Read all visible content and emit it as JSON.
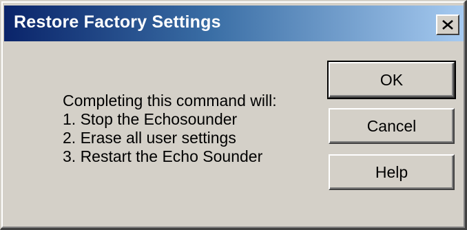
{
  "window": {
    "title": "Restore Factory Settings",
    "close_symbol": "close-icon"
  },
  "message": {
    "lines": [
      "Completing this command will:",
      "1. Stop the Echosounder",
      "2. Erase all user settings",
      "3. Restart the Echo Sounder"
    ]
  },
  "buttons": {
    "ok": "OK",
    "cancel": "Cancel",
    "help": "Help"
  },
  "colors": {
    "titlebar_start": "#0a246a",
    "titlebar_end": "#a6caf0",
    "face": "#d4d0c8"
  }
}
